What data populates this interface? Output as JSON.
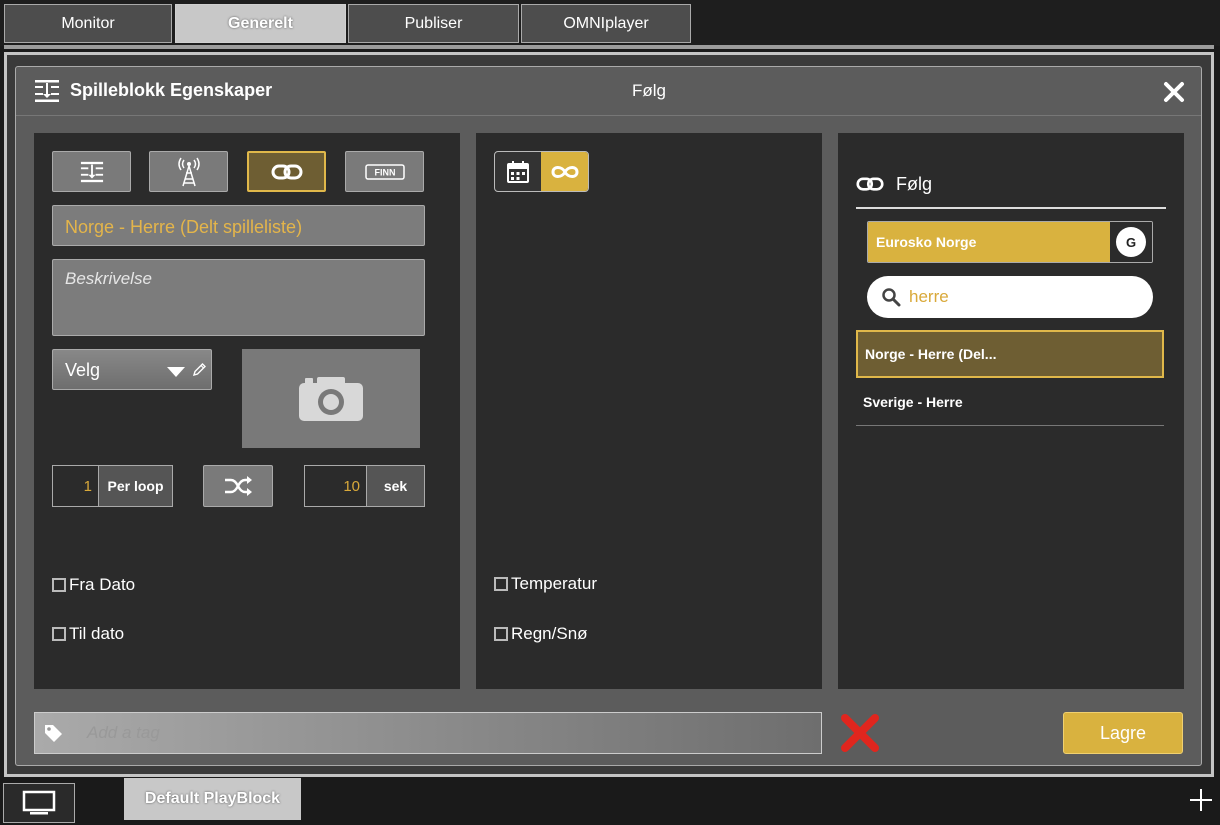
{
  "top_tabs": [
    {
      "label": "Monitor",
      "active": false
    },
    {
      "label": "Generelt",
      "active": true
    },
    {
      "label": "Publiser",
      "active": false
    },
    {
      "label": "OMNIplayer",
      "active": false
    }
  ],
  "dialog": {
    "title": "Spilleblokk Egenskaper",
    "subtitle": "Følg",
    "left": {
      "type_buttons": [
        "playlist-icon",
        "broadcast-tower-icon",
        "link-icon",
        "finn-logo-icon"
      ],
      "finn_logo_text": "FINN",
      "name_value": "Norge - Herre (Delt spilleliste)",
      "description_placeholder": "Beskrivelse",
      "select_value": "Velg",
      "loop_count": "1",
      "loop_unit": "Per loop",
      "duration": "10",
      "duration_unit": "sek",
      "from_date_label": "Fra Dato",
      "to_date_label": "Til dato"
    },
    "middle": {
      "temperature_label": "Temperatur",
      "rain_snow_label": "Regn/Snø"
    },
    "right": {
      "header": "Følg",
      "source_label": "Eurosko Norge",
      "source_badge": "G",
      "search_value": "herre",
      "items": [
        {
          "label": "Norge - Herre (Del...",
          "selected": true
        },
        {
          "label": "Sverige - Herre",
          "selected": false
        }
      ]
    },
    "tag_placeholder": "Add a tag",
    "save_label": "Lagre"
  },
  "bottom": {
    "tab_label": "Default PlayBlock"
  },
  "colors": {
    "accent": "#d9b23f",
    "accent_dark": "#6e5e33",
    "delete": "#e0261e"
  }
}
